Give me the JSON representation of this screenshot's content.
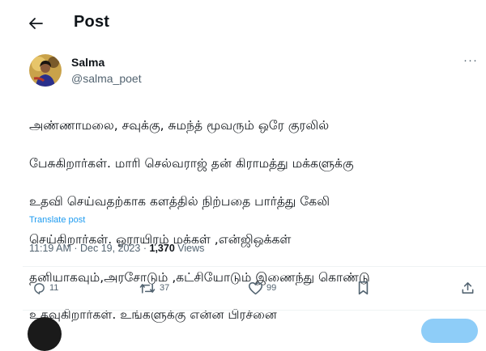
{
  "header": {
    "title": "Post"
  },
  "author": {
    "name": "Salma",
    "handle": "@salma_poet"
  },
  "post": {
    "text_lines": [
      "அண்ணாமலை, சவுக்கு, சுமந்த் மூவரும் ஒரே குரலில்",
      "பேசுகிறார்கள். மாரி செல்வராஜ் தன் கிராமத்து மக்களுக்கு",
      "உதவி செய்வதற்காக களத்தில் நிற்பதை பார்த்து கேலி",
      "செய்கிறார்கள். ஓராயிரம் மக்கள் ,என்ஜிஒக்கள்",
      "தனியாகவும்,அரசோடும் ,கட்சியோடும் இணைந்து கொண்டு",
      "உதவுகிறார்கள். உங்களுக்கு என்ன பிரச்னை"
    ],
    "translate_label": "Translate post",
    "time": "11:19 AM",
    "date": "Dec 19, 2023",
    "views_count": "1,370",
    "views_label": "Views"
  },
  "actions": {
    "replies": "11",
    "reposts": "37",
    "likes": "99"
  },
  "colors": {
    "accent": "#1d9bf0",
    "secondary_text": "#536471",
    "divider": "#eff3f4"
  },
  "icons": [
    "arrow-left-icon",
    "more-icon",
    "reply-icon",
    "repost-icon",
    "like-icon",
    "bookmark-icon",
    "share-icon"
  ]
}
